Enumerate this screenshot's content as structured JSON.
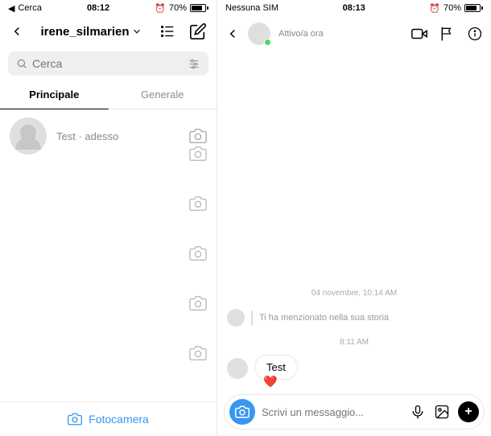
{
  "left": {
    "statusbar": {
      "back_app": "Cerca",
      "time": "08:12",
      "battery": "70%"
    },
    "header": {
      "username": "irene_silmarien"
    },
    "search": {
      "placeholder": "Cerca"
    },
    "tabs": {
      "primary": "Principale",
      "general": "Generale"
    },
    "threads": [
      {
        "preview": "Test · adesso"
      }
    ],
    "footer": {
      "camera": "Fotocamera"
    }
  },
  "right": {
    "statusbar": {
      "carrier": "Nessuna SIM",
      "time": "08:13",
      "battery": "70%"
    },
    "header": {
      "status": "Attivo/a ora"
    },
    "chat": {
      "timestamp1": "04 novembre, 10:14 AM",
      "mention": "Ti ha menzionato nella sua storia",
      "timestamp2": "8:11 AM",
      "message": "Test",
      "reaction": "❤️"
    },
    "composer": {
      "placeholder": "Scrivi un messaggio..."
    }
  }
}
